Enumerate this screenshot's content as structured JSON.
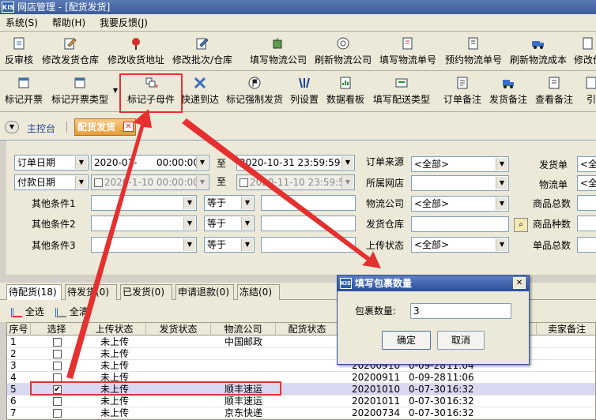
{
  "window": {
    "title": "网店管理 - [配货发货]",
    "logo": "KIS"
  },
  "menu": [
    "系统(S)",
    "帮助(H)",
    "我要反馈(J)"
  ],
  "toolbar1": [
    "反审核",
    "修改发货仓库",
    "修改收货地址",
    "修改批次/仓库",
    "填写物流公司",
    "刷新物流公司",
    "填写物流单号",
    "预约物流单号",
    "刷新物流成本",
    "修改价"
  ],
  "toolbar2": [
    "标记开票",
    "标记开票类型",
    "标记子母件",
    "快递到达",
    "标记强制发货",
    "列设置",
    "数据看板",
    "填写配送类型",
    "订单备注",
    "发货备注",
    "查看备注",
    "引"
  ],
  "tabs": {
    "home": "主控台",
    "active": "配货发货"
  },
  "filters": {
    "date1_type": "订单日期",
    "date1_from": "2020-01-",
    "date1_from_time": "00:00:00",
    "to": "至",
    "date1_to": "2020-10-31 23:59:59",
    "date2_type": "付款日期",
    "date2_from": "2020-1-10 00:00:00",
    "date2_to": "2020-11-10 23:59:59",
    "other1": "其他条件1",
    "other2": "其他条件2",
    "other3": "其他条件3",
    "eq": "等于",
    "order_source": "订单来源",
    "order_source_val": "<全部>",
    "shop": "所属网店",
    "logistics": "物流公司",
    "logistics_val": "<全部>",
    "warehouse": "发货仓库",
    "upload_status": "上传状态",
    "upload_status_val": "<全部>",
    "ship_order": "发货单",
    "ship_order_val": "<全",
    "waybill": "物流单",
    "waybill_val": "<全",
    "total_goods": "商品总数",
    "goods_kinds": "商品种数",
    "single_total": "单品总数"
  },
  "status_tabs": [
    "待配货(18)",
    "待发货(0)",
    "已发货(0)",
    "申请退款(0)",
    "冻结(0)"
  ],
  "select_all": "全选",
  "clear_all": "全清",
  "grid": {
    "headers": [
      "序号",
      "选择",
      "上传状态",
      "发货状态",
      "物流公司",
      "配货状态",
      "卖家备注"
    ],
    "rows": [
      {
        "no": "1",
        "checked": false,
        "upload": "未上传",
        "company": "中国邮政",
        "order": "",
        "date": "",
        "time": ""
      },
      {
        "no": "2",
        "checked": false,
        "upload": "未上传",
        "company": "",
        "order": "",
        "date": "",
        "time": ""
      },
      {
        "no": "3",
        "checked": false,
        "upload": "未上传",
        "company": "",
        "order": "20200910",
        "date": "0-09-28",
        "time": "11:04"
      },
      {
        "no": "4",
        "checked": false,
        "upload": "未上传",
        "company": "",
        "order": "20200911",
        "date": "0-09-28",
        "time": "11:06"
      },
      {
        "no": "5",
        "checked": true,
        "upload": "未上传",
        "company": "顺丰速运",
        "order": "20201010",
        "date": "0-07-30",
        "time": "16:32"
      },
      {
        "no": "6",
        "checked": false,
        "upload": "未上传",
        "company": "顺丰速运",
        "order": "20201011",
        "date": "0-07-30",
        "time": "16:32"
      },
      {
        "no": "7",
        "checked": false,
        "upload": "未上传",
        "company": "京东快递",
        "order": "20200734",
        "date": "0-07-30",
        "time": "16:32"
      }
    ]
  },
  "dialog": {
    "title": "填写包裹数量",
    "label": "包裹数量:",
    "value": "3",
    "ok": "确定",
    "cancel": "取消"
  },
  "colors": {
    "title_bar": "#3b5c9a",
    "annotation_red": "#e53030",
    "selected_row": "#d8d8f0"
  }
}
